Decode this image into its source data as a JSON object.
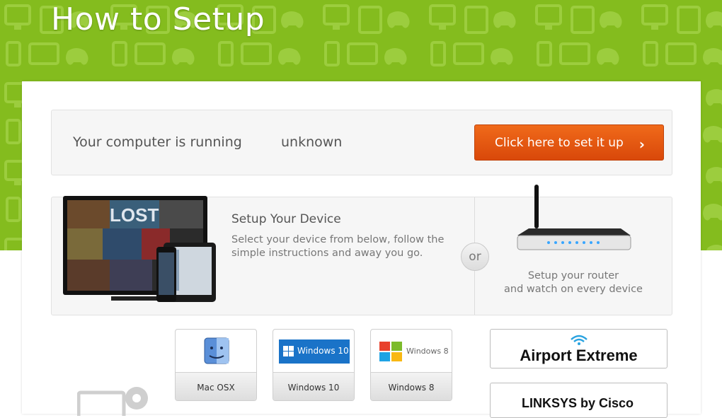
{
  "header": {
    "title": "How to Setup"
  },
  "detect": {
    "label": "Your computer is running",
    "os": "unknown",
    "button_label": "Click here to set it up",
    "button_chevron": "›"
  },
  "device": {
    "title": "Setup Your Device",
    "description": "Select your device from below, follow the simple instructions and away you go.",
    "tv_screen_text": "LOST"
  },
  "or_label": "or",
  "router": {
    "caption_line1": "Setup your router",
    "caption_line2": "and watch on every device"
  },
  "os_cards": [
    {
      "name": "Mac OSX",
      "icon": "finder-icon"
    },
    {
      "name": "Windows 10",
      "icon": "windows-10-logo",
      "logo_text": "Windows 10"
    },
    {
      "name": "Windows 8",
      "icon": "windows-8-logo",
      "logo_text": "Windows 8"
    }
  ],
  "router_cards": [
    {
      "name": "Airport Extreme",
      "icon": "wifi-icon"
    },
    {
      "name": "LINKSYS by Cisco",
      "icon": "linksys-logo"
    }
  ],
  "colors": {
    "hero_green": "#84bc1e",
    "button_orange": "#e55a12",
    "panel_bg": "#f6f6f6",
    "windows_blue": "#1a73c8"
  }
}
